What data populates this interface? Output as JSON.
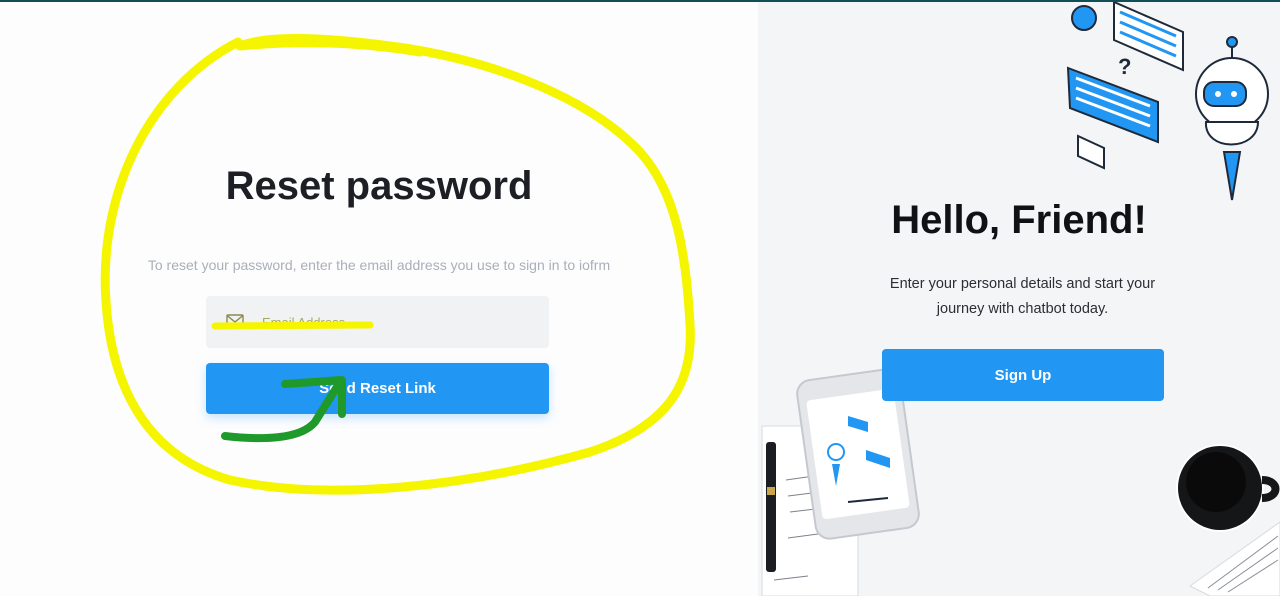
{
  "reset": {
    "title": "Reset password",
    "subtitle": "To reset your password, enter the email address you use to sign in to iofrm",
    "email_placeholder": "Email Address",
    "email_value": "",
    "send_label": "Send Reset Link"
  },
  "side": {
    "title": "Hello, Friend!",
    "description": "Enter your personal details and start your journey with chatbot today.",
    "signup_label": "Sign Up"
  },
  "colors": {
    "accent": "#2196f3",
    "annotation_yellow": "#f5f500",
    "annotation_green": "#1f9a2a",
    "top_bar": "#0f4f55"
  },
  "icons": {
    "email": "mail-icon"
  }
}
